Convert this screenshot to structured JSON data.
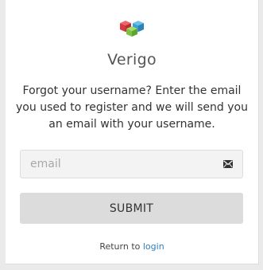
{
  "brand": {
    "name": "Verigo",
    "logo_icon": "cubes-logo-icon",
    "colors": [
      "#e2414a",
      "#3aa0d6",
      "#7cc242"
    ]
  },
  "instructions": "Forgot your username? Enter the email you used to register and we will send you an email with your username.",
  "email_field": {
    "placeholder": "email",
    "value": "",
    "icon": "envelope-icon"
  },
  "submit_button": {
    "label": "SUBMIT"
  },
  "return_link": {
    "prefix": "Return to",
    "link_label": "login",
    "link_color": "#2a7fbf"
  }
}
